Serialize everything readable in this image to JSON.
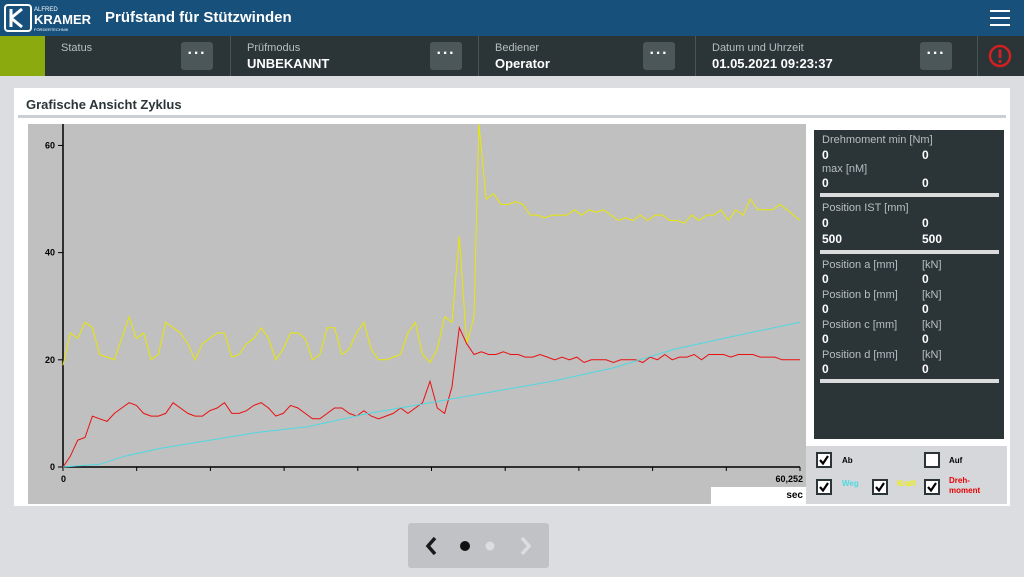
{
  "app": {
    "title": "Prüfstand für Stützwinden",
    "logo_top": "ALFRED",
    "logo_main": "KRAMER",
    "logo_sub": "FÖRDERTECHNIK"
  },
  "status": {
    "status_label": "Status",
    "mode_label": "Prüfmodus",
    "mode_value": "UNBEKANNT",
    "operator_label": "Bediener",
    "operator_value": "Operator",
    "datetime_label": "Datum und Uhrzeit",
    "datetime_value": "01.05.2021 09:23:37",
    "more_glyph": "···"
  },
  "panel": {
    "title": "Grafische Ansicht Zyklus"
  },
  "info": {
    "torque_min_label": "Drehmoment min [Nm]",
    "torque_min_a": "0",
    "torque_min_b": "0",
    "torque_max_label": "max [nM]",
    "torque_max_a": "0",
    "torque_max_b": "0",
    "pos_ist_label": "Position IST [mm]",
    "pos_ist_a": "0",
    "pos_ist_b": "0",
    "pos_ist_c": "500",
    "pos_ist_d": "500",
    "pos_a_label": "Position a [mm]",
    "pos_a_unit": "[kN]",
    "pos_a_1": "0",
    "pos_a_2": "0",
    "pos_b_label": "Position b [mm]",
    "pos_b_unit": "[kN]",
    "pos_b_1": "0",
    "pos_b_2": "0",
    "pos_c_label": "Position c [mm]",
    "pos_c_unit": "[kN]",
    "pos_c_1": "0",
    "pos_c_2": "0",
    "pos_d_label": "Position d [mm]",
    "pos_d_unit": "[kN]",
    "pos_d_1": "0",
    "pos_d_2": "0"
  },
  "checks": {
    "ab": {
      "label": "Ab",
      "checked": true
    },
    "auf": {
      "label": "Auf",
      "checked": false
    },
    "weg": {
      "label": "Weg",
      "checked": true,
      "color": "#4fd8e0"
    },
    "kraft": {
      "label": "Kraft",
      "checked": true,
      "color": "#f0f000"
    },
    "dreh_line1": "Dreh-",
    "dreh_line2": "moment",
    "dreh_checked": true,
    "dreh_color": "#e80000"
  },
  "colors": {
    "titlebar": "#17507a",
    "statusbar": "#2b3538",
    "accent": "#8aaa0d",
    "alarm": "#d02020",
    "plot_bg": "#c0c0c0"
  },
  "chart_data": {
    "type": "line",
    "xlim": [
      0,
      60.252
    ],
    "ylim": [
      0,
      64
    ],
    "x_ticks": [
      "0",
      "60,252"
    ],
    "x_unit": "sec",
    "y_ticks": [
      0,
      20,
      40,
      60
    ],
    "grid": false,
    "series": [
      {
        "color": "#e8e800",
        "values": [
          [
            0,
            19
          ],
          [
            0.6,
            25
          ],
          [
            1.2,
            24
          ],
          [
            1.8,
            27
          ],
          [
            2.4,
            26
          ],
          [
            3.0,
            21
          ],
          [
            3.6,
            20.5
          ],
          [
            4.2,
            20
          ],
          [
            4.8,
            24
          ],
          [
            5.4,
            28
          ],
          [
            6.0,
            24
          ],
          [
            6.6,
            25
          ],
          [
            7.2,
            20
          ],
          [
            7.8,
            21
          ],
          [
            8.4,
            27
          ],
          [
            9.0,
            26
          ],
          [
            9.6,
            25
          ],
          [
            10.2,
            23
          ],
          [
            10.8,
            20
          ],
          [
            11.4,
            23
          ],
          [
            12.0,
            24
          ],
          [
            12.6,
            25
          ],
          [
            13.2,
            25
          ],
          [
            13.8,
            20.5
          ],
          [
            14.4,
            21
          ],
          [
            15.0,
            23
          ],
          [
            15.6,
            24
          ],
          [
            16.2,
            26
          ],
          [
            16.8,
            24
          ],
          [
            17.4,
            20
          ],
          [
            18.0,
            22
          ],
          [
            18.6,
            25
          ],
          [
            19.2,
            25
          ],
          [
            19.8,
            24
          ],
          [
            20.4,
            20
          ],
          [
            21.0,
            21
          ],
          [
            21.6,
            26
          ],
          [
            22.2,
            26
          ],
          [
            22.8,
            21
          ],
          [
            23.4,
            22
          ],
          [
            24.0,
            25
          ],
          [
            24.6,
            27
          ],
          [
            25.2,
            22
          ],
          [
            25.8,
            20
          ],
          [
            26.4,
            20
          ],
          [
            27.0,
            20.5
          ],
          [
            27.6,
            21
          ],
          [
            28.2,
            25
          ],
          [
            28.8,
            27
          ],
          [
            29.4,
            21
          ],
          [
            30.0,
            19.5
          ],
          [
            30.6,
            22
          ],
          [
            31.2,
            28
          ],
          [
            31.8,
            27
          ],
          [
            32.4,
            43
          ],
          [
            33.0,
            23
          ],
          [
            33.6,
            28
          ],
          [
            34.0,
            64
          ],
          [
            34.6,
            50
          ],
          [
            35.2,
            51
          ],
          [
            35.8,
            49
          ],
          [
            36.4,
            49
          ],
          [
            37.0,
            49.5
          ],
          [
            37.6,
            49
          ],
          [
            38.2,
            47
          ],
          [
            38.8,
            47
          ],
          [
            39.4,
            46.5
          ],
          [
            40.0,
            47
          ],
          [
            40.6,
            47
          ],
          [
            41.2,
            47
          ],
          [
            41.8,
            48
          ],
          [
            42.4,
            47
          ],
          [
            43.0,
            48
          ],
          [
            43.6,
            47.5
          ],
          [
            44.2,
            48
          ],
          [
            44.8,
            47
          ],
          [
            45.4,
            46
          ],
          [
            46.0,
            46.5
          ],
          [
            46.6,
            46
          ],
          [
            47.2,
            47
          ],
          [
            47.8,
            46
          ],
          [
            48.4,
            47
          ],
          [
            49.0,
            47
          ],
          [
            49.6,
            46
          ],
          [
            50.2,
            46
          ],
          [
            50.8,
            45.5
          ],
          [
            51.4,
            47
          ],
          [
            52.0,
            46
          ],
          [
            52.6,
            47
          ],
          [
            53.2,
            47
          ],
          [
            53.8,
            48
          ],
          [
            54.4,
            46
          ],
          [
            55.0,
            48
          ],
          [
            55.6,
            47
          ],
          [
            56.2,
            50
          ],
          [
            56.8,
            48
          ],
          [
            57.4,
            48
          ],
          [
            58.0,
            48
          ],
          [
            58.6,
            49
          ],
          [
            59.2,
            48
          ],
          [
            60.252,
            46
          ]
        ]
      },
      {
        "color": "#e81010",
        "values": [
          [
            0,
            0
          ],
          [
            0.6,
            2
          ],
          [
            1.2,
            5
          ],
          [
            1.8,
            5.5
          ],
          [
            2.4,
            9.5
          ],
          [
            3.0,
            9
          ],
          [
            3.6,
            8.5
          ],
          [
            4.2,
            10
          ],
          [
            4.8,
            11
          ],
          [
            5.4,
            12
          ],
          [
            6.0,
            11.5
          ],
          [
            6.6,
            10
          ],
          [
            7.2,
            9.5
          ],
          [
            7.8,
            9.5
          ],
          [
            8.4,
            10
          ],
          [
            9.0,
            12
          ],
          [
            9.6,
            11
          ],
          [
            10.2,
            10
          ],
          [
            10.8,
            9.5
          ],
          [
            11.4,
            9.5
          ],
          [
            12.0,
            10.5
          ],
          [
            12.6,
            11
          ],
          [
            13.2,
            12
          ],
          [
            13.8,
            10
          ],
          [
            14.4,
            10
          ],
          [
            15.0,
            10.5
          ],
          [
            15.6,
            11.5
          ],
          [
            16.2,
            12
          ],
          [
            16.8,
            11
          ],
          [
            17.4,
            9.5
          ],
          [
            18.0,
            10
          ],
          [
            18.6,
            11.5
          ],
          [
            19.2,
            11
          ],
          [
            19.8,
            10
          ],
          [
            20.4,
            9
          ],
          [
            21.0,
            9
          ],
          [
            21.6,
            10
          ],
          [
            22.2,
            11
          ],
          [
            22.8,
            11
          ],
          [
            23.4,
            10
          ],
          [
            24.0,
            9.5
          ],
          [
            24.6,
            10.5
          ],
          [
            25.2,
            9.5
          ],
          [
            25.8,
            9
          ],
          [
            26.4,
            9.5
          ],
          [
            27.0,
            10
          ],
          [
            27.6,
            11
          ],
          [
            28.2,
            10
          ],
          [
            28.8,
            11
          ],
          [
            29.4,
            12
          ],
          [
            30.0,
            16
          ],
          [
            30.6,
            11
          ],
          [
            31.2,
            10
          ],
          [
            31.8,
            15
          ],
          [
            32.4,
            26
          ],
          [
            33.0,
            23
          ],
          [
            33.6,
            21
          ],
          [
            34.2,
            21.5
          ],
          [
            34.8,
            21
          ],
          [
            35.4,
            21
          ],
          [
            36.0,
            21.5
          ],
          [
            36.6,
            21
          ],
          [
            37.2,
            21
          ],
          [
            37.8,
            20.5
          ],
          [
            38.4,
            20.5
          ],
          [
            39.0,
            21
          ],
          [
            39.6,
            20.5
          ],
          [
            40.2,
            20
          ],
          [
            40.8,
            20.5
          ],
          [
            41.4,
            20
          ],
          [
            42.0,
            20.5
          ],
          [
            42.6,
            19.5
          ],
          [
            43.2,
            20
          ],
          [
            43.8,
            20
          ],
          [
            44.4,
            20
          ],
          [
            45.0,
            19.5
          ],
          [
            45.6,
            20
          ],
          [
            46.2,
            20
          ],
          [
            46.8,
            20
          ],
          [
            47.4,
            19.5
          ],
          [
            48.0,
            20.5
          ],
          [
            48.6,
            20
          ],
          [
            49.2,
            21
          ],
          [
            49.8,
            20
          ],
          [
            50.4,
            20.5
          ],
          [
            51.0,
            20.5
          ],
          [
            51.6,
            21
          ],
          [
            52.2,
            20
          ],
          [
            52.8,
            21
          ],
          [
            53.4,
            21
          ],
          [
            54.0,
            21
          ],
          [
            54.6,
            20.5
          ],
          [
            55.2,
            21
          ],
          [
            55.8,
            21
          ],
          [
            56.4,
            21
          ],
          [
            57.0,
            20.5
          ],
          [
            57.6,
            20.5
          ],
          [
            58.2,
            20.5
          ],
          [
            58.8,
            20
          ],
          [
            59.4,
            20
          ],
          [
            60.252,
            20
          ]
        ]
      },
      {
        "color": "#4fd8e0",
        "values": [
          [
            0,
            0
          ],
          [
            3,
            0.5
          ],
          [
            5,
            2
          ],
          [
            8,
            3.5
          ],
          [
            12,
            5
          ],
          [
            16,
            6.5
          ],
          [
            20,
            7.5
          ],
          [
            25,
            10
          ],
          [
            30,
            12
          ],
          [
            35,
            14
          ],
          [
            40,
            16
          ],
          [
            45,
            18.5
          ],
          [
            50,
            22
          ],
          [
            55,
            24.5
          ],
          [
            60.252,
            27
          ]
        ]
      }
    ]
  }
}
